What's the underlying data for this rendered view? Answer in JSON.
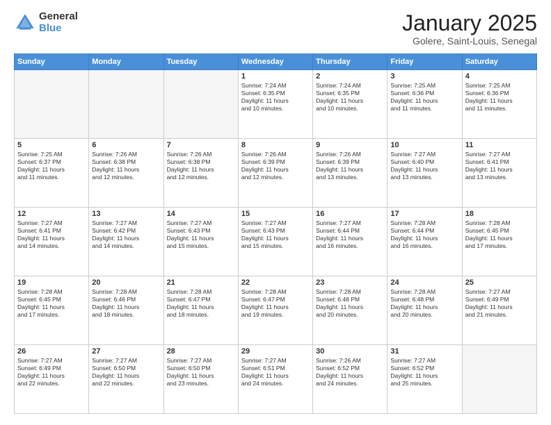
{
  "logo": {
    "general": "General",
    "blue": "Blue"
  },
  "header": {
    "month": "January 2025",
    "location": "Golere, Saint-Louis, Senegal"
  },
  "weekdays": [
    "Sunday",
    "Monday",
    "Tuesday",
    "Wednesday",
    "Thursday",
    "Friday",
    "Saturday"
  ],
  "weeks": [
    [
      {
        "day": "",
        "content": "",
        "empty": true
      },
      {
        "day": "",
        "content": "",
        "empty": true
      },
      {
        "day": "",
        "content": "",
        "empty": true
      },
      {
        "day": "1",
        "content": "Sunrise: 7:24 AM\nSunset: 6:35 PM\nDaylight: 11 hours\nand 10 minutes."
      },
      {
        "day": "2",
        "content": "Sunrise: 7:24 AM\nSunset: 6:35 PM\nDaylight: 11 hours\nand 10 minutes."
      },
      {
        "day": "3",
        "content": "Sunrise: 7:25 AM\nSunset: 6:36 PM\nDaylight: 11 hours\nand 11 minutes."
      },
      {
        "day": "4",
        "content": "Sunrise: 7:25 AM\nSunset: 6:36 PM\nDaylight: 11 hours\nand 11 minutes."
      }
    ],
    [
      {
        "day": "5",
        "content": "Sunrise: 7:25 AM\nSunset: 6:37 PM\nDaylight: 11 hours\nand 11 minutes."
      },
      {
        "day": "6",
        "content": "Sunrise: 7:26 AM\nSunset: 6:38 PM\nDaylight: 11 hours\nand 12 minutes."
      },
      {
        "day": "7",
        "content": "Sunrise: 7:26 AM\nSunset: 6:38 PM\nDaylight: 11 hours\nand 12 minutes."
      },
      {
        "day": "8",
        "content": "Sunrise: 7:26 AM\nSunset: 6:39 PM\nDaylight: 11 hours\nand 12 minutes."
      },
      {
        "day": "9",
        "content": "Sunrise: 7:26 AM\nSunset: 6:39 PM\nDaylight: 11 hours\nand 13 minutes."
      },
      {
        "day": "10",
        "content": "Sunrise: 7:27 AM\nSunset: 6:40 PM\nDaylight: 11 hours\nand 13 minutes."
      },
      {
        "day": "11",
        "content": "Sunrise: 7:27 AM\nSunset: 6:41 PM\nDaylight: 11 hours\nand 13 minutes."
      }
    ],
    [
      {
        "day": "12",
        "content": "Sunrise: 7:27 AM\nSunset: 6:41 PM\nDaylight: 11 hours\nand 14 minutes."
      },
      {
        "day": "13",
        "content": "Sunrise: 7:27 AM\nSunset: 6:42 PM\nDaylight: 11 hours\nand 14 minutes."
      },
      {
        "day": "14",
        "content": "Sunrise: 7:27 AM\nSunset: 6:43 PM\nDaylight: 11 hours\nand 15 minutes."
      },
      {
        "day": "15",
        "content": "Sunrise: 7:27 AM\nSunset: 6:43 PM\nDaylight: 11 hours\nand 15 minutes."
      },
      {
        "day": "16",
        "content": "Sunrise: 7:27 AM\nSunset: 6:44 PM\nDaylight: 11 hours\nand 16 minutes."
      },
      {
        "day": "17",
        "content": "Sunrise: 7:28 AM\nSunset: 6:44 PM\nDaylight: 11 hours\nand 16 minutes."
      },
      {
        "day": "18",
        "content": "Sunrise: 7:28 AM\nSunset: 6:45 PM\nDaylight: 11 hours\nand 17 minutes."
      }
    ],
    [
      {
        "day": "19",
        "content": "Sunrise: 7:28 AM\nSunset: 6:45 PM\nDaylight: 11 hours\nand 17 minutes."
      },
      {
        "day": "20",
        "content": "Sunrise: 7:28 AM\nSunset: 6:46 PM\nDaylight: 11 hours\nand 18 minutes."
      },
      {
        "day": "21",
        "content": "Sunrise: 7:28 AM\nSunset: 6:47 PM\nDaylight: 11 hours\nand 18 minutes."
      },
      {
        "day": "22",
        "content": "Sunrise: 7:28 AM\nSunset: 6:47 PM\nDaylight: 11 hours\nand 19 minutes."
      },
      {
        "day": "23",
        "content": "Sunrise: 7:28 AM\nSunset: 6:48 PM\nDaylight: 11 hours\nand 20 minutes."
      },
      {
        "day": "24",
        "content": "Sunrise: 7:28 AM\nSunset: 6:48 PM\nDaylight: 11 hours\nand 20 minutes."
      },
      {
        "day": "25",
        "content": "Sunrise: 7:27 AM\nSunset: 6:49 PM\nDaylight: 11 hours\nand 21 minutes."
      }
    ],
    [
      {
        "day": "26",
        "content": "Sunrise: 7:27 AM\nSunset: 6:49 PM\nDaylight: 11 hours\nand 22 minutes."
      },
      {
        "day": "27",
        "content": "Sunrise: 7:27 AM\nSunset: 6:50 PM\nDaylight: 11 hours\nand 22 minutes."
      },
      {
        "day": "28",
        "content": "Sunrise: 7:27 AM\nSunset: 6:50 PM\nDaylight: 11 hours\nand 23 minutes."
      },
      {
        "day": "29",
        "content": "Sunrise: 7:27 AM\nSunset: 6:51 PM\nDaylight: 11 hours\nand 24 minutes."
      },
      {
        "day": "30",
        "content": "Sunrise: 7:26 AM\nSunset: 6:52 PM\nDaylight: 11 hours\nand 24 minutes."
      },
      {
        "day": "31",
        "content": "Sunrise: 7:27 AM\nSunset: 6:52 PM\nDaylight: 11 hours\nand 25 minutes."
      },
      {
        "day": "",
        "content": "",
        "empty": true
      }
    ]
  ]
}
